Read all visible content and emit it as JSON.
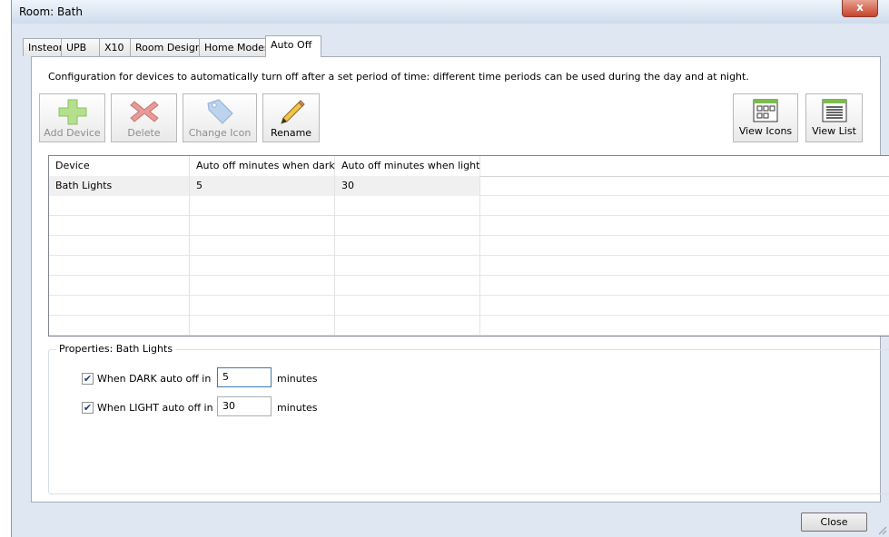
{
  "window": {
    "title": "Room: Bath",
    "close_glyph": "x"
  },
  "tabs": [
    {
      "label": "Insteon"
    },
    {
      "label": "UPB"
    },
    {
      "label": "X10"
    },
    {
      "label": "Room Design"
    },
    {
      "label": "Home Modes"
    },
    {
      "label": "Auto Off",
      "active": true
    }
  ],
  "description": "Configuration for devices to automatically turn off after a set period of time: different time periods can be used during the day and at night.",
  "toolbar": {
    "add_device": "Add Device",
    "delete": "Delete",
    "change_icon": "Change Icon",
    "rename": "Rename",
    "view_icons": "View Icons",
    "view_list": "View List"
  },
  "table": {
    "columns": [
      "Device",
      "Auto off minutes when dark",
      "Auto off minutes when light"
    ],
    "rows": [
      [
        "Bath Lights",
        "5",
        "30"
      ]
    ]
  },
  "properties": {
    "legend": "Properties: Bath Lights",
    "dark": {
      "label": "When DARK auto off in",
      "value": "5",
      "unit": "minutes",
      "checked": true
    },
    "light": {
      "label": "When LIGHT auto off in",
      "value": "30",
      "unit": "minutes",
      "checked": true
    }
  },
  "footer": {
    "close_label": "Close"
  },
  "colors": {
    "title_bar": "#cfdced",
    "close_red": "#c7432b",
    "selected_row": "#f0f0f0"
  }
}
